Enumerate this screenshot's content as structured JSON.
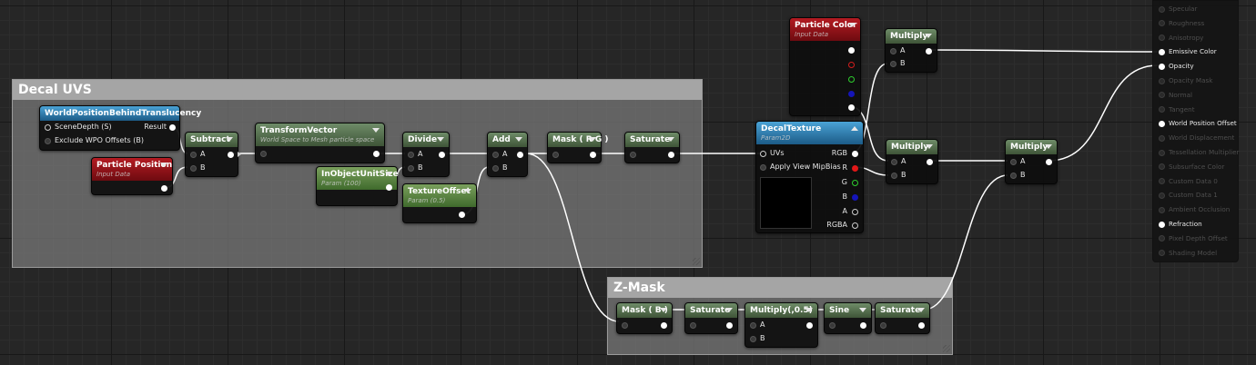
{
  "comments": {
    "decal_uvs": "Decal UVS",
    "z_mask": "Z-Mask"
  },
  "nodes": {
    "world_pos": {
      "title": "WorldPositionBehindTranslucency",
      "in1": "SceneDepth (S)",
      "in2": "Exclude WPO Offsets (B)",
      "out": "Result"
    },
    "particle_position": {
      "title": "Particle Position",
      "sub": "Input Data"
    },
    "subtract": {
      "title": "Subtract",
      "a": "A",
      "b": "B"
    },
    "transform_vector": {
      "title": "TransformVector",
      "sub": "World Space to Mesh particle space"
    },
    "in_object_unit_size": {
      "title": "InObjectUnitSize",
      "sub": "Param (100)"
    },
    "divide": {
      "title": "Divide",
      "a": "A",
      "b": "B"
    },
    "texture_offset": {
      "title": "TextureOffset",
      "sub": "Param (0.5)"
    },
    "add": {
      "title": "Add",
      "a": "A",
      "b": "B"
    },
    "mask_rg": {
      "title": "Mask ( R G )"
    },
    "saturate1": {
      "title": "Saturate"
    },
    "decal_texture": {
      "title": "DecalTexture",
      "sub": "Param2D",
      "uvs": "UVs",
      "mip": "Apply View MipBias",
      "rgb": "RGB",
      "r": "R",
      "g": "G",
      "b": "B",
      "a": "A",
      "rgba": "RGBA"
    },
    "particle_color": {
      "title": "Particle Color",
      "sub": "Input Data"
    },
    "multiply_top": {
      "title": "Multiply",
      "a": "A",
      "b": "B"
    },
    "multiply_mid": {
      "title": "Multiply",
      "a": "A",
      "b": "B"
    },
    "multiply_right": {
      "title": "Multiply",
      "a": "A",
      "b": "B"
    },
    "mask_b": {
      "title": "Mask ( B )"
    },
    "saturate2": {
      "title": "Saturate"
    },
    "multiply_half": {
      "title": "Multiply(,0.5)",
      "a": "A",
      "b": "B"
    },
    "sine": {
      "title": "Sine"
    },
    "saturate3": {
      "title": "Saturate"
    }
  },
  "result_pins": [
    {
      "label": "Specular",
      "active": false
    },
    {
      "label": "Roughness",
      "active": false
    },
    {
      "label": "Anisotropy",
      "active": false
    },
    {
      "label": "Emissive Color",
      "active": true
    },
    {
      "label": "Opacity",
      "active": true
    },
    {
      "label": "Opacity Mask",
      "active": false
    },
    {
      "label": "Normal",
      "active": false
    },
    {
      "label": "Tangent",
      "active": false
    },
    {
      "label": "World Position Offset",
      "active": true
    },
    {
      "label": "World Displacement",
      "active": false
    },
    {
      "label": "Tessellation Multiplier",
      "active": false
    },
    {
      "label": "Subsurface Color",
      "active": false
    },
    {
      "label": "Custom Data 0",
      "active": false
    },
    {
      "label": "Custom Data 1",
      "active": false
    },
    {
      "label": "Ambient Occlusion",
      "active": false
    },
    {
      "label": "Refraction",
      "active": true
    },
    {
      "label": "Pixel Depth Offset",
      "active": false
    },
    {
      "label": "Shading Model",
      "active": false
    }
  ],
  "colors": {
    "graph_background": "#262626",
    "comment_title": "#a5a5a5",
    "math_header": "#3e5437",
    "param_header": "#3f6a2c",
    "input_data_header": "#6e0b10",
    "texture_header": "#1c5b87",
    "wire": "#ffffff"
  }
}
